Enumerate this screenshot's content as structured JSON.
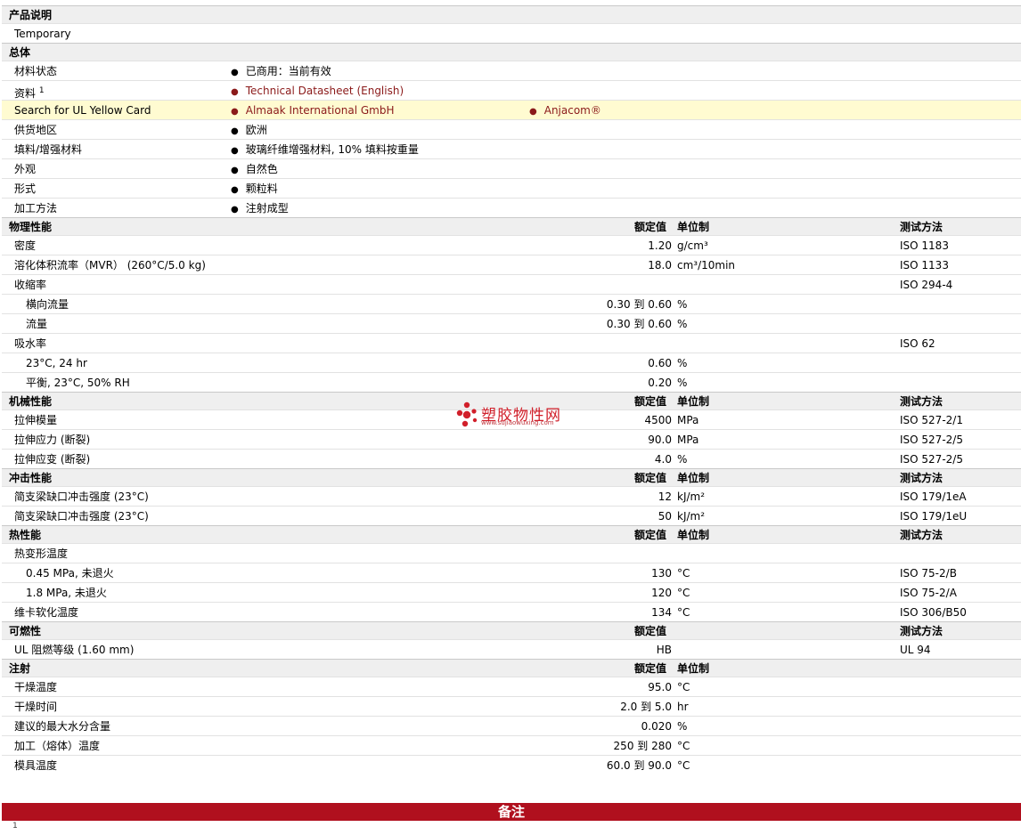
{
  "description_section": {
    "title": "产品说明",
    "text": "Temporary"
  },
  "general": {
    "title": "总体",
    "rows": [
      {
        "label": "材料状态",
        "values": [
          "已商用：当前有效"
        ]
      },
      {
        "label": "资料",
        "sup": "1",
        "links": [
          "Technical Datasheet (English)"
        ]
      },
      {
        "label": "Search for UL Yellow Card",
        "links": [
          "Almaak International GmbH",
          "Anjacom®"
        ]
      },
      {
        "label": "供货地区",
        "values": [
          "欧洲"
        ]
      },
      {
        "label": "填料/增强材料",
        "values": [
          "玻璃纤维增强材料, 10% 填料按重量"
        ]
      },
      {
        "label": "外观",
        "values": [
          "自然色"
        ]
      },
      {
        "label": "形式",
        "values": [
          "颗粒料"
        ]
      },
      {
        "label": "加工方法",
        "values": [
          "注射成型"
        ]
      }
    ]
  },
  "headers": {
    "value": "额定值",
    "unit": "单位制",
    "method": "测试方法"
  },
  "physical": {
    "title": "物理性能",
    "rows": [
      {
        "label": "密度",
        "value": "1.20",
        "unit": "g/cm³",
        "method": "ISO 1183"
      },
      {
        "label": "溶化体积流率（MVR） (260°C/5.0 kg)",
        "value": "18.0",
        "unit": "cm³/10min",
        "method": "ISO 1133"
      },
      {
        "label": "收缩率",
        "value": "",
        "unit": "",
        "method": "ISO 294-4"
      },
      {
        "label": "横向流量",
        "value": "0.30 到  0.60",
        "unit": "%",
        "method": ""
      },
      {
        "label": "流量",
        "value": "0.30 到  0.60",
        "unit": "%",
        "method": ""
      },
      {
        "label": "吸水率",
        "value": "",
        "unit": "",
        "method": "ISO 62"
      },
      {
        "label": "23°C, 24 hr",
        "value": "0.60",
        "unit": "%",
        "method": ""
      },
      {
        "label": "平衡, 23°C, 50% RH",
        "value": "0.20",
        "unit": "%",
        "method": ""
      }
    ]
  },
  "mechanical": {
    "title": "机械性能",
    "rows": [
      {
        "label": "拉伸模量",
        "value": "4500",
        "unit": "MPa",
        "method": "ISO 527-2/1"
      },
      {
        "label": "拉伸应力 (断裂)",
        "value": "90.0",
        "unit": "MPa",
        "method": "ISO 527-2/5"
      },
      {
        "label": "拉伸应变 (断裂)",
        "value": "4.0",
        "unit": "%",
        "method": "ISO 527-2/5"
      }
    ]
  },
  "impact": {
    "title": "冲击性能",
    "rows": [
      {
        "label": "简支梁缺口冲击强度 (23°C)",
        "value": "12",
        "unit": "kJ/m²",
        "method": "ISO 179/1eA"
      },
      {
        "label": "简支梁缺口冲击强度 (23°C)",
        "value": "50",
        "unit": "kJ/m²",
        "method": "ISO 179/1eU"
      }
    ]
  },
  "thermal": {
    "title": "热性能",
    "rows": [
      {
        "label": "热变形温度",
        "value": "",
        "unit": "",
        "method": ""
      },
      {
        "label": "0.45 MPa, 未退火",
        "value": "130",
        "unit": "°C",
        "method": "ISO 75-2/B"
      },
      {
        "label": "1.8 MPa, 未退火",
        "value": "120",
        "unit": "°C",
        "method": "ISO 75-2/A"
      },
      {
        "label": "维卡软化温度",
        "value": "134",
        "unit": "°C",
        "method": "ISO 306/B50"
      }
    ]
  },
  "flammability": {
    "title": "可燃性",
    "rows": [
      {
        "label": "UL 阻燃等级 (1.60 mm)",
        "value": "HB",
        "unit": "",
        "method": "UL 94"
      }
    ]
  },
  "injection": {
    "title": "注射",
    "rows": [
      {
        "label": "干燥温度",
        "value": "95.0",
        "unit": "°C"
      },
      {
        "label": "干燥时间",
        "value": "2.0 到  5.0",
        "unit": "hr"
      },
      {
        "label": "建议的最大水分含量",
        "value": "0.020",
        "unit": "%"
      },
      {
        "label": "加工（熔体）温度",
        "value": "250 到  280",
        "unit": "°C"
      },
      {
        "label": "模具温度",
        "value": "60.0 到  90.0",
        "unit": "°C"
      }
    ]
  },
  "notes": {
    "title": "备注",
    "footnote_mark": "1"
  },
  "watermark": {
    "title": "塑胶物性网",
    "url": "www.sujiaowuxing.com"
  },
  "colors": {
    "section_bg": "#efefef",
    "highlight_bg": "#fffbd1",
    "link": "#8b1a1a",
    "notes_bar": "#b0101e",
    "watermark": "#d11f2a"
  }
}
